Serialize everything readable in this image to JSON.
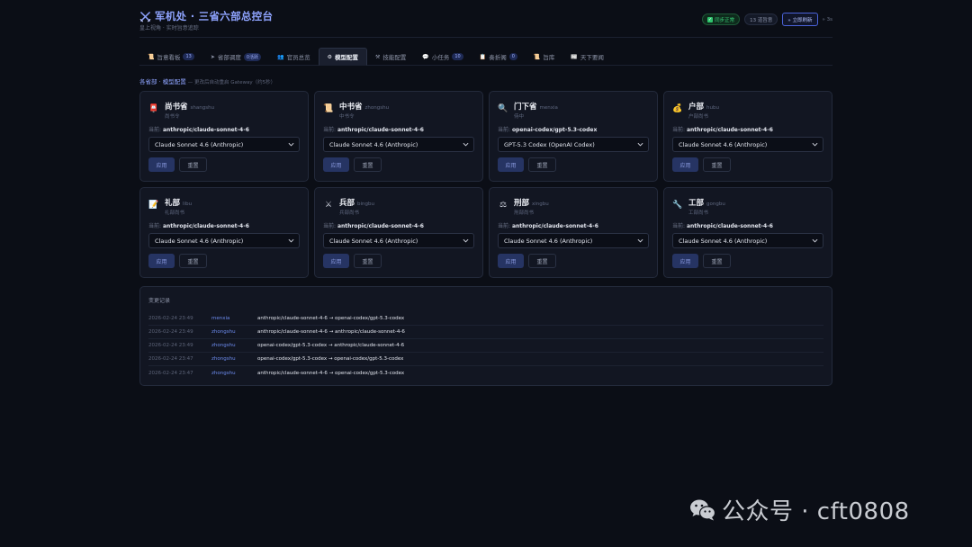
{
  "header": {
    "title": "军机处 · 三省六部总控台",
    "subtitle": "皇上视角 · 实时旨意追踪",
    "sync_status": "同步正常",
    "count_badge": "13 道旨意",
    "refresh_button": "» 立即刷新",
    "countdown": "» 3s"
  },
  "tabs": [
    {
      "icon": "scroll-icon",
      "glyph": "📜",
      "label": "旨意看板",
      "badge": "13"
    },
    {
      "icon": "send-icon",
      "glyph": "➤",
      "label": "省部调度",
      "badge": "0活跃"
    },
    {
      "icon": "people-icon",
      "glyph": "👥",
      "label": "官员总览",
      "badge": ""
    },
    {
      "icon": "gear-icon",
      "glyph": "⚙",
      "label": "模型配置",
      "badge": "",
      "active": true
    },
    {
      "icon": "tools-icon",
      "glyph": "⚒",
      "label": "技能配置",
      "badge": ""
    },
    {
      "icon": "chat-icon",
      "glyph": "💬",
      "label": "小任务",
      "badge": "10"
    },
    {
      "icon": "memo-icon",
      "glyph": "📋",
      "label": "奏折阁",
      "badge": "0"
    },
    {
      "icon": "book-icon",
      "glyph": "📜",
      "label": "旨库",
      "badge": ""
    },
    {
      "icon": "news-icon",
      "glyph": "📰",
      "label": "天下要闻",
      "badge": ""
    }
  ],
  "section": {
    "title": "各省部 · 模型配置",
    "note": "— 更改后自动重启 Gateway（约5秒）"
  },
  "labels": {
    "current_prefix": "当前: ",
    "apply": "应用",
    "reset": "重置"
  },
  "departments": [
    {
      "name": "尚书省",
      "key": "shangshu",
      "role": "尚书令",
      "icon": "seal-icon",
      "glyph": "📮",
      "current": "anthropic/claude-sonnet-4-6",
      "selected": "Claude Sonnet 4.6 (Anthropic)"
    },
    {
      "name": "中书省",
      "key": "zhongshu",
      "role": "中书令",
      "icon": "scroll-icon",
      "glyph": "📜",
      "current": "anthropic/claude-sonnet-4-6",
      "selected": "Claude Sonnet 4.6 (Anthropic)"
    },
    {
      "name": "门下省",
      "key": "menxia",
      "role": "侍中",
      "icon": "magnifier-icon",
      "glyph": "🔍",
      "current": "openai-codex/gpt-5.3-codex",
      "selected": "GPT-5.3 Codex (OpenAI Codex)"
    },
    {
      "name": "户部",
      "key": "hubu",
      "role": "户部尚书",
      "icon": "money-bag-icon",
      "glyph": "💰",
      "current": "anthropic/claude-sonnet-4-6",
      "selected": "Claude Sonnet 4.6 (Anthropic)"
    },
    {
      "name": "礼部",
      "key": "libu",
      "role": "礼部尚书",
      "icon": "memo-icon",
      "glyph": "📝",
      "current": "anthropic/claude-sonnet-4-6",
      "selected": "Claude Sonnet 4.6 (Anthropic)"
    },
    {
      "name": "兵部",
      "key": "bingbu",
      "role": "兵部尚书",
      "icon": "crossed-swords-icon",
      "glyph": "⚔",
      "current": "anthropic/claude-sonnet-4-6",
      "selected": "Claude Sonnet 4.6 (Anthropic)"
    },
    {
      "name": "刑部",
      "key": "xingbu",
      "role": "刑部尚书",
      "icon": "scales-icon",
      "glyph": "⚖",
      "current": "anthropic/claude-sonnet-4-6",
      "selected": "Claude Sonnet 4.6 (Anthropic)"
    },
    {
      "name": "工部",
      "key": "gongbu",
      "role": "工部尚书",
      "icon": "wrench-icon",
      "glyph": "🔧",
      "current": "anthropic/claude-sonnet-4-6",
      "selected": "Claude Sonnet 4.6 (Anthropic)"
    }
  ],
  "change_log": {
    "title": "变更记录",
    "entries": [
      {
        "time": "2026-02-24 23:49",
        "dept": "menxia",
        "change": "anthropic/claude-sonnet-4-6 → openai-codex/gpt-5.3-codex"
      },
      {
        "time": "2026-02-24 23:49",
        "dept": "zhongshu",
        "change": "anthropic/claude-sonnet-4-6 → anthropic/claude-sonnet-4-6"
      },
      {
        "time": "2026-02-24 23:49",
        "dept": "zhongshu",
        "change": "openai-codex/gpt-5.3-codex → anthropic/claude-sonnet-4-6"
      },
      {
        "time": "2026-02-24 23:47",
        "dept": "zhongshu",
        "change": "openai-codex/gpt-5.3-codex → openai-codex/gpt-5.3-codex"
      },
      {
        "time": "2026-02-24 23:47",
        "dept": "zhongshu",
        "change": "anthropic/claude-sonnet-4-6 → openai-codex/gpt-5.3-codex"
      }
    ]
  },
  "watermark": {
    "text": "公众号 · cft0808",
    "icon": "wechat-icon"
  }
}
